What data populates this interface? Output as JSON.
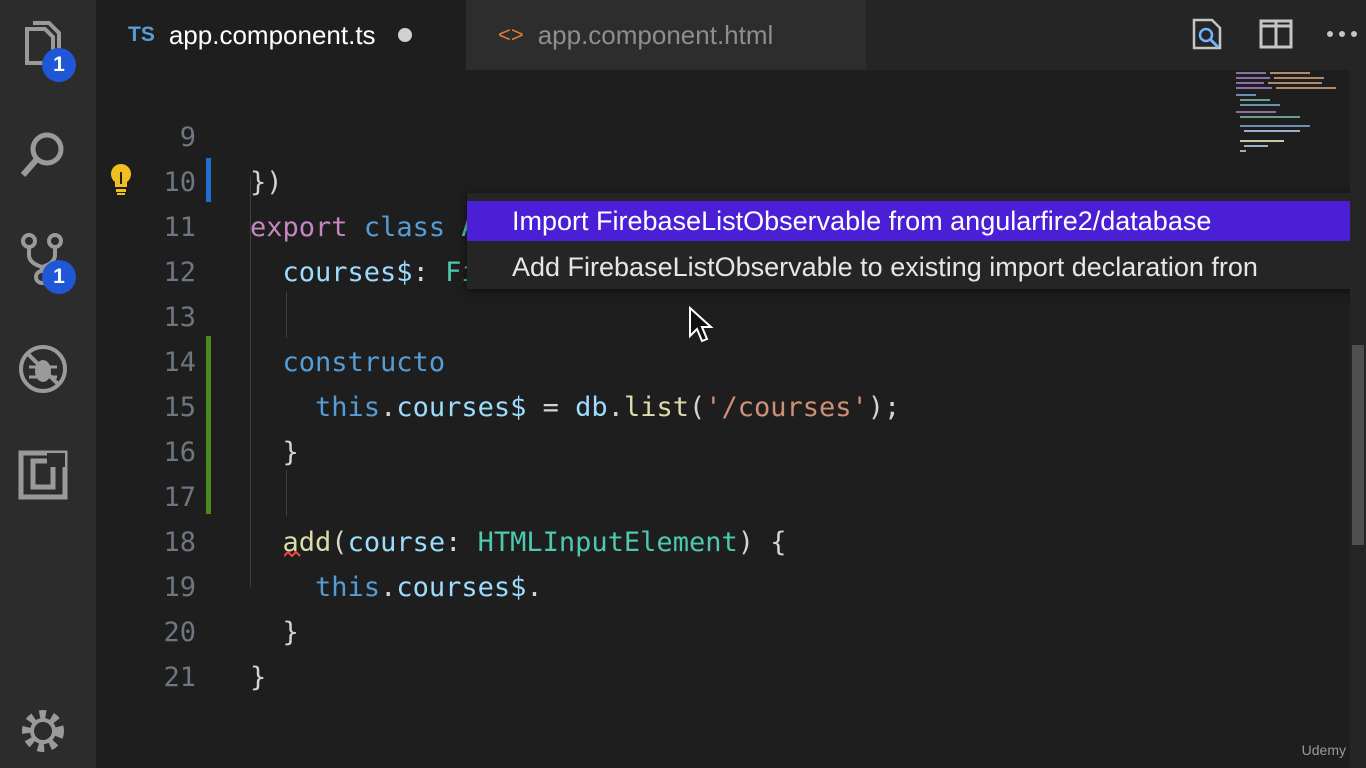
{
  "tabs": [
    {
      "badge": "TS",
      "label": "app.component.ts",
      "modified": true,
      "active": true
    },
    {
      "badge": "<>",
      "label": "app.component.html",
      "active": false
    }
  ],
  "activity_bar": {
    "explorer_badge": "1",
    "scm_badge": "1",
    "icons": [
      "files-icon",
      "search-icon",
      "source-control-icon",
      "debug-icon",
      "extensions-icon",
      "gear-icon"
    ]
  },
  "editor_actions": [
    "open-preview-icon",
    "split-editor-icon",
    "more-actions-icon"
  ],
  "code_lines": [
    {
      "n": "9",
      "t": "})"
    },
    {
      "n": "10",
      "t": "export class AppComponent {"
    },
    {
      "n": "11",
      "t": "  courses$: FirebaseListObservable<any[]>;"
    },
    {
      "n": "12",
      "t": ""
    },
    {
      "n": "13",
      "t": "  constructo"
    },
    {
      "n": "14",
      "t": "    this.courses$ = db.list('/courses');"
    },
    {
      "n": "15",
      "t": "  }"
    },
    {
      "n": "16",
      "t": ""
    },
    {
      "n": "17",
      "t": "  add(course: HTMLInputElement) {"
    },
    {
      "n": "18",
      "t": "    this.courses$."
    },
    {
      "n": "19",
      "t": "  }"
    },
    {
      "n": "20",
      "t": "}"
    },
    {
      "n": "21",
      "t": ""
    }
  ],
  "quick_fix": {
    "items": [
      "Import FirebaseListObservable from angularfire2/database",
      "Add FirebaseListObservable to existing import declaration fron"
    ],
    "selected_index": 0
  },
  "watermark": "Udemy",
  "colors": {
    "background": "#1e1e1e",
    "activity_bar": "#2c2c2c",
    "badge": "#1f57d6",
    "selection": "#4b1fd6",
    "keyword": "#c586c0",
    "type": "#4ec9b0",
    "property": "#9cdcfe",
    "string": "#ce9178",
    "function": "#dcdcaa"
  }
}
